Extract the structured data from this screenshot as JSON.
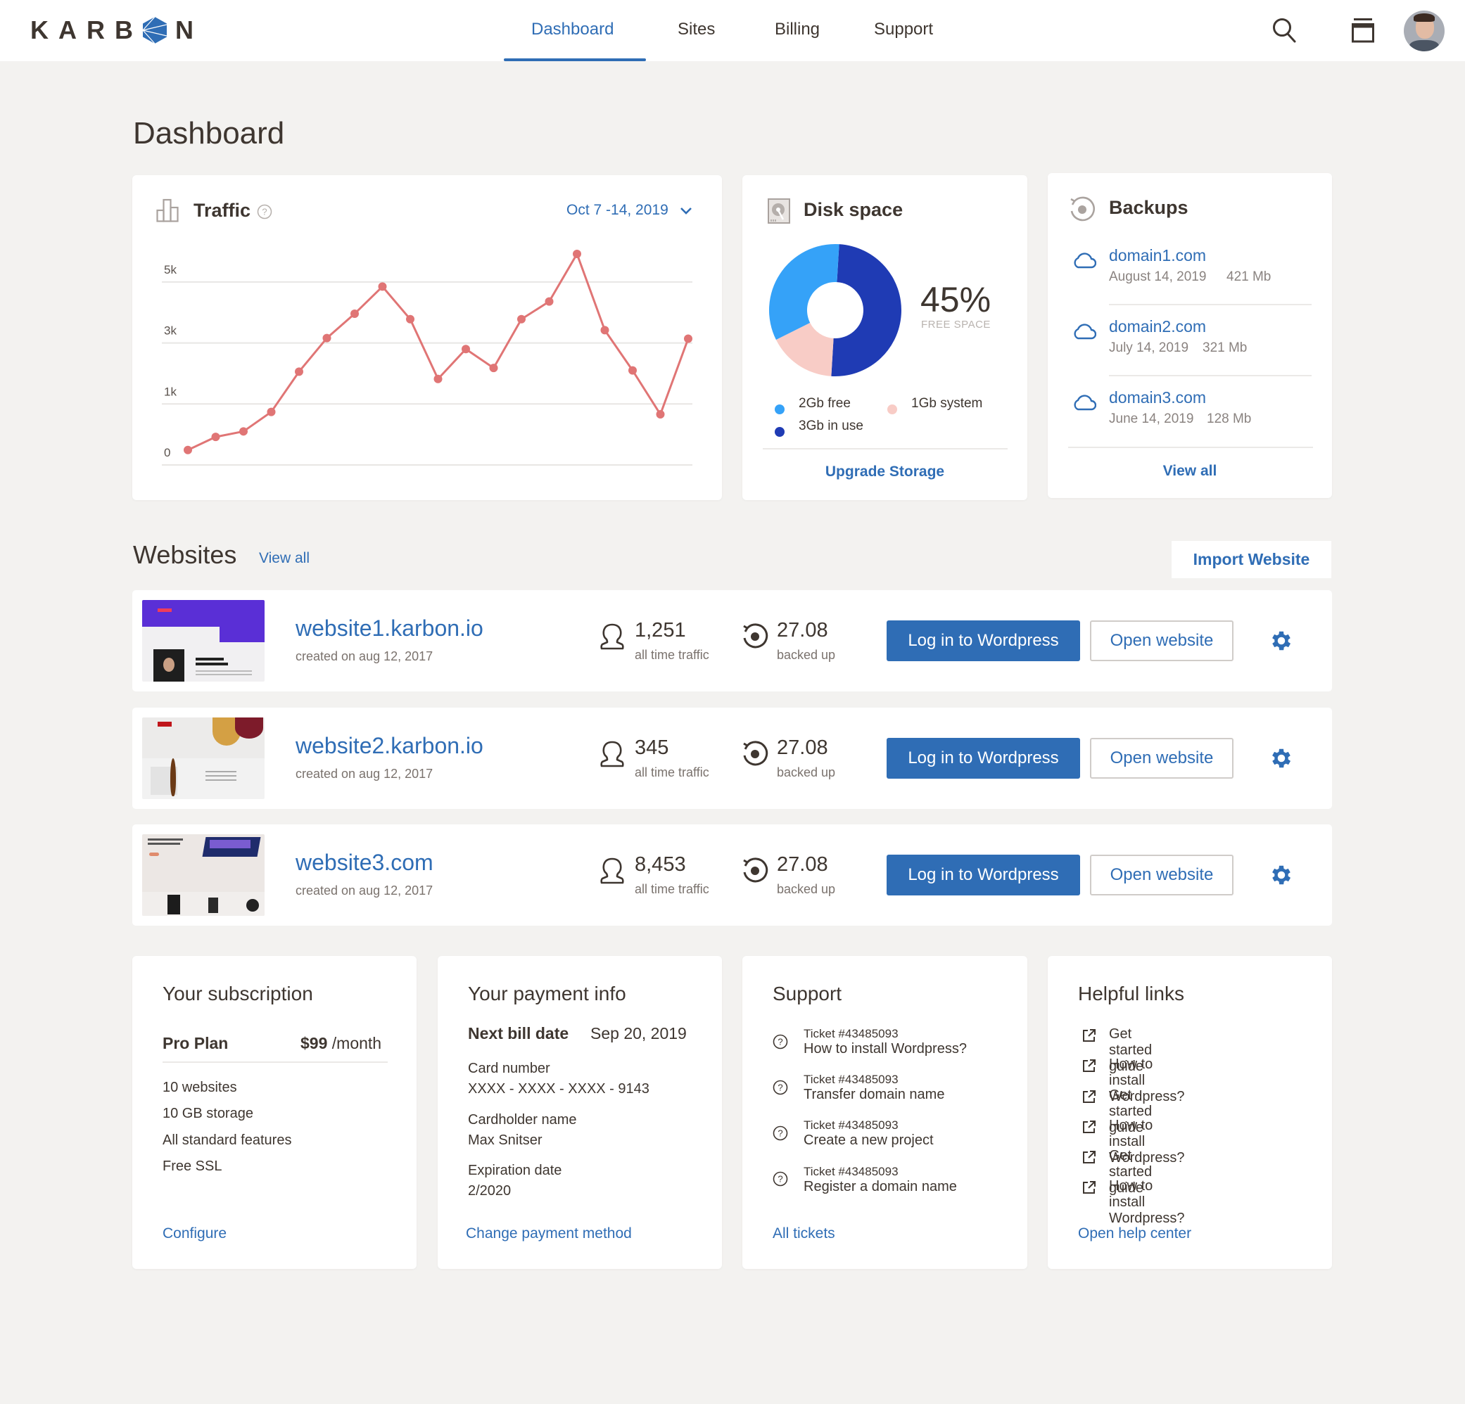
{
  "header": {
    "logo_text": "KARBON",
    "nav": [
      {
        "label": "Dashboard",
        "active": true
      },
      {
        "label": "Sites",
        "active": false
      },
      {
        "label": "Billing",
        "active": false
      },
      {
        "label": "Support",
        "active": false
      }
    ],
    "icons": {
      "search": "search-icon",
      "archive": "archive-icon",
      "avatar": "user-avatar"
    }
  },
  "page_title": "Dashboard",
  "traffic": {
    "title": "Traffic",
    "date_range": "Oct 7 -14, 2019"
  },
  "chart_data": {
    "type": "line",
    "title": "Traffic",
    "xlabel": "",
    "ylabel": "",
    "y_ticks": [
      "0",
      "1k",
      "3k",
      "5k"
    ],
    "y_tick_values": [
      0,
      1000,
      3000,
      5000
    ],
    "x": [
      1,
      2,
      3,
      4,
      5,
      6,
      7,
      8,
      9,
      10,
      11,
      12,
      13,
      14,
      15,
      16,
      17,
      18,
      19
    ],
    "values": [
      245,
      460,
      550,
      870,
      2060,
      3160,
      3960,
      4850,
      3780,
      1820,
      2800,
      2180,
      3780,
      4360,
      5920,
      3420,
      2100,
      830,
      3140
    ],
    "color": "#e07575",
    "grid": true
  },
  "disk": {
    "title": "Disk space",
    "percent": "45%",
    "percent_label": "FREE SPACE",
    "legend": [
      {
        "label": "2Gb free",
        "color": "#35a2f8"
      },
      {
        "label": "1Gb system",
        "color": "#f8ccc6"
      },
      {
        "label": "3Gb in use",
        "color": "#1f3bb4"
      }
    ],
    "donut": [
      {
        "name": "in use",
        "value": 3,
        "color": "#1f3bb4"
      },
      {
        "name": "system",
        "value": 1,
        "color": "#f8ccc6"
      },
      {
        "name": "free",
        "value": 2,
        "color": "#35a2f8"
      }
    ],
    "upgrade_label": "Upgrade Storage"
  },
  "backups": {
    "title": "Backups",
    "items": [
      {
        "domain": "domain1.com",
        "date": "August 14, 2019",
        "size": "421 Mb"
      },
      {
        "domain": "domain2.com",
        "date": "July 14, 2019",
        "size": "321 Mb"
      },
      {
        "domain": "domain3.com",
        "date": "June 14, 2019",
        "size": "128 Mb"
      }
    ],
    "view_all": "View all"
  },
  "websites": {
    "title": "Websites",
    "view_all": "View all",
    "import_label": "Import Website",
    "login_label": "Log in to Wordpress",
    "open_label": "Open website",
    "traffic_label": "all time traffic",
    "backup_label": "backed up",
    "rows": [
      {
        "name": "website1.karbon.io",
        "created": "created on aug 12, 2017",
        "traffic": "1,251",
        "backup": "27.08"
      },
      {
        "name": "website2.karbon.io",
        "created": "created on aug 12, 2017",
        "traffic": "345",
        "backup": "27.08"
      },
      {
        "name": "website3.com",
        "created": "created on aug 12, 2017",
        "traffic": "8,453",
        "backup": "27.08"
      }
    ]
  },
  "subscription": {
    "title": "Your subscription",
    "plan": "Pro Plan",
    "price": "$99",
    "period": "/month",
    "features": [
      "10 websites",
      "10 GB storage",
      "All standard features",
      "Free SSL"
    ],
    "configure": "Configure"
  },
  "payment": {
    "title": "Your payment info",
    "next_bill_label": "Next bill date",
    "next_bill_value": "Sep 20, 2019",
    "card_label": "Card number",
    "card_value": "XXXX - XXXX - XXXX - 9143",
    "holder_label": "Cardholder name",
    "holder_value": "Max Snitser",
    "exp_label": "Expiration date",
    "exp_value": "2/2020",
    "change": "Change payment method"
  },
  "support": {
    "title": "Support",
    "tickets": [
      {
        "id": "Ticket #43485093",
        "subject": "How to install Wordpress?"
      },
      {
        "id": "Ticket #43485093",
        "subject": "Transfer domain name"
      },
      {
        "id": "Ticket #43485093",
        "subject": "Create a new project"
      },
      {
        "id": "Ticket #43485093",
        "subject": "Register a domain name"
      }
    ],
    "all_tickets": "All tickets"
  },
  "helpful": {
    "title": "Helpful links",
    "links": [
      "Get started guide",
      "How to install Wordpress?",
      "Get started guide",
      "How to install Wordpress?",
      "Get started guide",
      "How to install Wordpress?"
    ],
    "open_help": "Open help center"
  }
}
